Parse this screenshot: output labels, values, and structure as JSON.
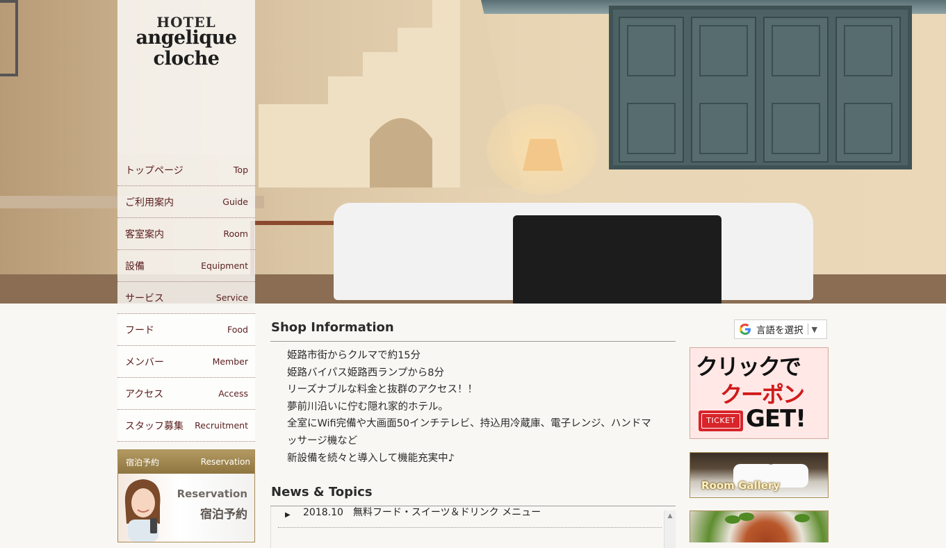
{
  "logo": {
    "hotel": "HOTEL",
    "line1": "angelique",
    "line2": "cloche"
  },
  "nav": [
    {
      "jp": "トップページ",
      "en": "Top"
    },
    {
      "jp": "ご利用案内",
      "en": "Guide"
    },
    {
      "jp": "客室案内",
      "en": "Room"
    },
    {
      "jp": "設備",
      "en": "Equipment"
    },
    {
      "jp": "サービス",
      "en": "Service"
    },
    {
      "jp": "フード",
      "en": "Food"
    },
    {
      "jp": "メンバー",
      "en": "Member"
    },
    {
      "jp": "アクセス",
      "en": "Access"
    },
    {
      "jp": "スタッフ募集",
      "en": "Recruitment"
    }
  ],
  "reservation": {
    "head_jp": "宿泊予約",
    "head_en": "Reservation",
    "banner_en": "Reservation",
    "banner_jp": "宿泊予約"
  },
  "shop": {
    "title": "Shop Information",
    "lines": [
      "姫路市街からクルマで約15分",
      "姫路バイパス姫路西ランプから8分",
      "リーズナブルな料金と抜群のアクセス！！",
      "夢前川沿いに佇む隠れ家的ホテル。",
      "全室にWifi完備や大画面50インチテレビ、持込用冷蔵庫、電子レンジ、ハンドマ",
      "ッサージ機など",
      "新設備を続々と導入して機能充実中♪"
    ]
  },
  "news": {
    "title": "News & Topics",
    "items": [
      "2018.10　無料フード・スイーツ＆ドリンク メニュー"
    ]
  },
  "translate": {
    "label": "言語を選択",
    "arrow": "▼"
  },
  "coupon": {
    "line1": "クリックで",
    "line2": "クーポン",
    "ticket": "TICKET",
    "get": "GET!"
  },
  "gallery": {
    "label": "Room Gallery"
  },
  "colors": {
    "nav_text": "#5a1e1e",
    "gold": "#a88a52",
    "coupon_red": "#d01a1a"
  },
  "icons": {
    "translate": "google-g-icon",
    "news_bullet": "triangle-right-icon",
    "scroll_up": "chevron-up-icon"
  }
}
